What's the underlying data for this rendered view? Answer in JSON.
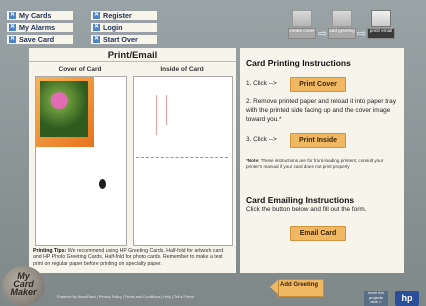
{
  "nav": {
    "my_cards": "My Cards",
    "register": "Register",
    "my_alarms": "My Alarms",
    "login": "Login",
    "save_card": "Save Card",
    "start_over": "Start Over"
  },
  "steps": [
    {
      "label": "create cover"
    },
    {
      "label": "add greeting"
    },
    {
      "label": "print/ email"
    }
  ],
  "left_panel": {
    "title": "Print/Email",
    "cover_title": "Cover of Card",
    "inside_title": "Inside of Card",
    "tips_bold": "Printing Tips:",
    "tips_text": "We recommend using HP Greeting Cards, Half-fold for artwork card and HP Photo Greeting Cards, Half-fold for photo cards.  Remember to make a test print on regular paper before printing on specialty paper."
  },
  "right_panel": {
    "print_heading": "Card Printing Instructions",
    "step1_prefix": "1. Click -->",
    "print_cover_button": "Print Cover",
    "step2_text": "2. Remove printed paper and reload it into paper tray with the printed side facing up and the cover image toward you.*",
    "step3_prefix": "3. Click -->",
    "print_inside_button": "Print Inside",
    "note_bold": "*Note:",
    "note_text": "These instructions are for front-loading printers; consult your printer's manual if your card does not print properly",
    "email_heading": "Card Emailing Instructions",
    "email_instructions": "Click the button below and fill out the form.",
    "email_button": "Email Card"
  },
  "bottom": {
    "logo_line1": "My",
    "logo_line2": "Card",
    "logo_line3": "Maker",
    "footer_text": "Powered by NewsFlash  |  Privacy Policy  |  Terms and Conditions  |  Help  |  Tell a Friend",
    "add_greeting_button": "Add Greeting",
    "more_fun": "more fun projects",
    "more_fun_sub": "click >",
    "hp_logo": "hp"
  }
}
